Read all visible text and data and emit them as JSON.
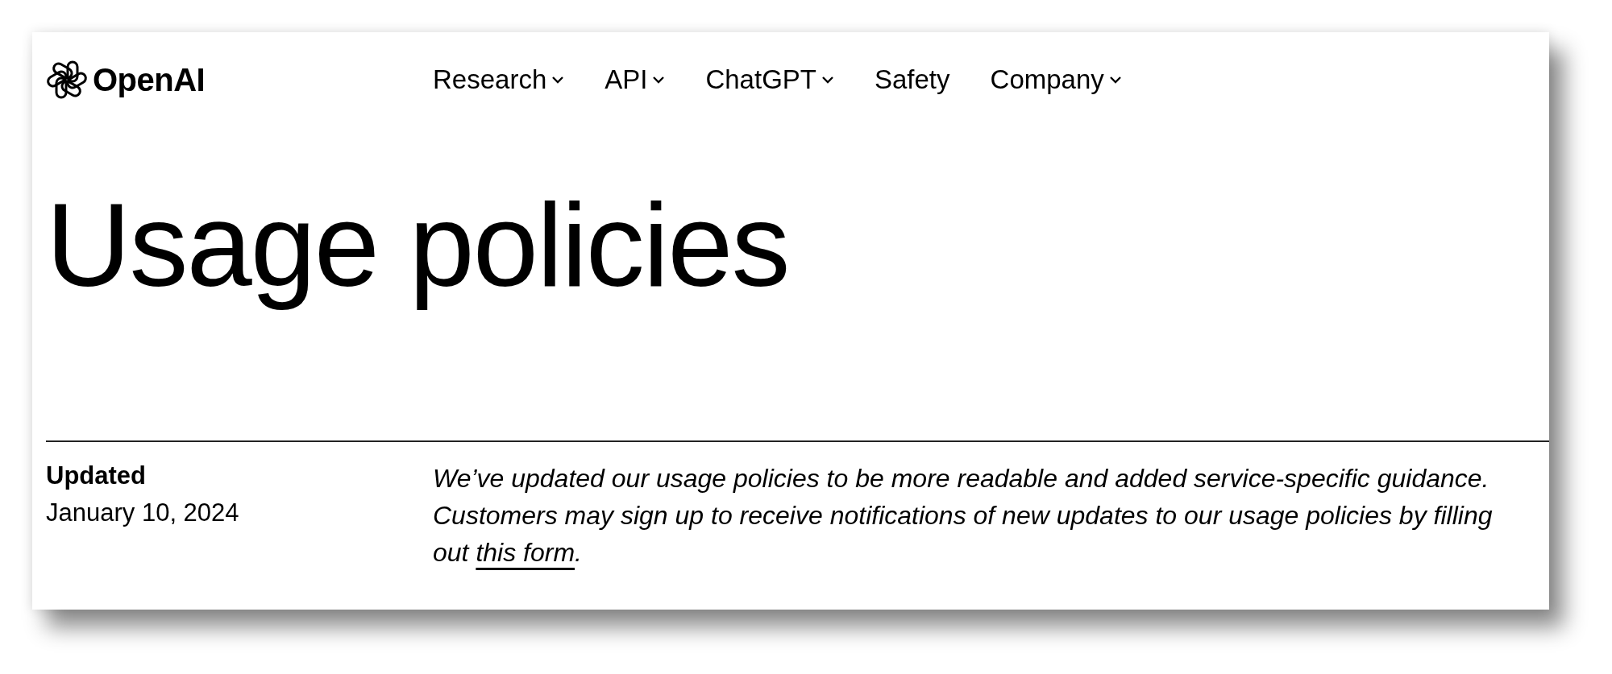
{
  "header": {
    "brand": "OpenAI",
    "nav": [
      {
        "label": "Research",
        "dropdown": true
      },
      {
        "label": "API",
        "dropdown": true
      },
      {
        "label": "ChatGPT",
        "dropdown": true
      },
      {
        "label": "Safety",
        "dropdown": false
      },
      {
        "label": "Company",
        "dropdown": true
      }
    ]
  },
  "title": "Usage policies",
  "meta": {
    "label": "Updated",
    "date": "January 10, 2024"
  },
  "notice": {
    "text_before": "We’ve updated our usage policies to be more readable and added service-specific guidance. Customers may sign up to receive notifications of new updates to our usage policies by filling out ",
    "link": "this form",
    "text_after": "."
  }
}
